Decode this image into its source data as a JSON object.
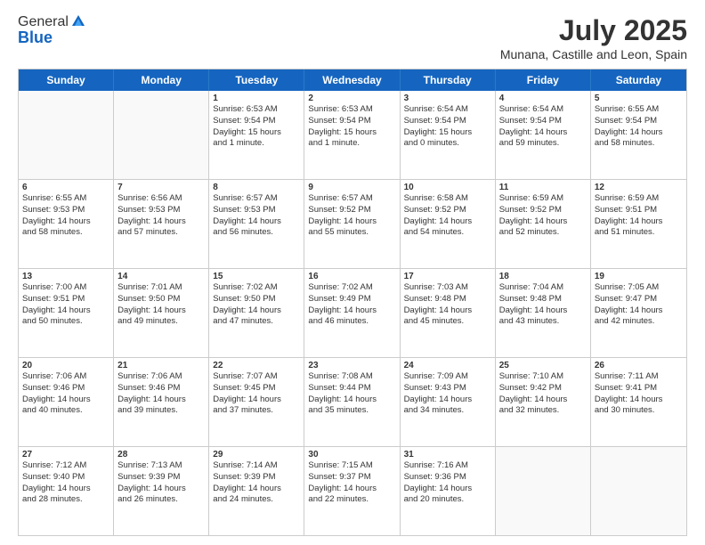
{
  "logo": {
    "general": "General",
    "blue": "Blue"
  },
  "title": "July 2025",
  "subtitle": "Munana, Castille and Leon, Spain",
  "header_days": [
    "Sunday",
    "Monday",
    "Tuesday",
    "Wednesday",
    "Thursday",
    "Friday",
    "Saturday"
  ],
  "weeks": [
    [
      {
        "day": null
      },
      {
        "day": null
      },
      {
        "day": "1",
        "sunrise": "Sunrise: 6:53 AM",
        "sunset": "Sunset: 9:54 PM",
        "daylight": "Daylight: 15 hours and 1 minute."
      },
      {
        "day": "2",
        "sunrise": "Sunrise: 6:53 AM",
        "sunset": "Sunset: 9:54 PM",
        "daylight": "Daylight: 15 hours and 1 minute."
      },
      {
        "day": "3",
        "sunrise": "Sunrise: 6:54 AM",
        "sunset": "Sunset: 9:54 PM",
        "daylight": "Daylight: 15 hours and 0 minutes."
      },
      {
        "day": "4",
        "sunrise": "Sunrise: 6:54 AM",
        "sunset": "Sunset: 9:54 PM",
        "daylight": "Daylight: 14 hours and 59 minutes."
      },
      {
        "day": "5",
        "sunrise": "Sunrise: 6:55 AM",
        "sunset": "Sunset: 9:54 PM",
        "daylight": "Daylight: 14 hours and 58 minutes."
      }
    ],
    [
      {
        "day": "6",
        "sunrise": "Sunrise: 6:55 AM",
        "sunset": "Sunset: 9:53 PM",
        "daylight": "Daylight: 14 hours and 58 minutes."
      },
      {
        "day": "7",
        "sunrise": "Sunrise: 6:56 AM",
        "sunset": "Sunset: 9:53 PM",
        "daylight": "Daylight: 14 hours and 57 minutes."
      },
      {
        "day": "8",
        "sunrise": "Sunrise: 6:57 AM",
        "sunset": "Sunset: 9:53 PM",
        "daylight": "Daylight: 14 hours and 56 minutes."
      },
      {
        "day": "9",
        "sunrise": "Sunrise: 6:57 AM",
        "sunset": "Sunset: 9:52 PM",
        "daylight": "Daylight: 14 hours and 55 minutes."
      },
      {
        "day": "10",
        "sunrise": "Sunrise: 6:58 AM",
        "sunset": "Sunset: 9:52 PM",
        "daylight": "Daylight: 14 hours and 54 minutes."
      },
      {
        "day": "11",
        "sunrise": "Sunrise: 6:59 AM",
        "sunset": "Sunset: 9:52 PM",
        "daylight": "Daylight: 14 hours and 52 minutes."
      },
      {
        "day": "12",
        "sunrise": "Sunrise: 6:59 AM",
        "sunset": "Sunset: 9:51 PM",
        "daylight": "Daylight: 14 hours and 51 minutes."
      }
    ],
    [
      {
        "day": "13",
        "sunrise": "Sunrise: 7:00 AM",
        "sunset": "Sunset: 9:51 PM",
        "daylight": "Daylight: 14 hours and 50 minutes."
      },
      {
        "day": "14",
        "sunrise": "Sunrise: 7:01 AM",
        "sunset": "Sunset: 9:50 PM",
        "daylight": "Daylight: 14 hours and 49 minutes."
      },
      {
        "day": "15",
        "sunrise": "Sunrise: 7:02 AM",
        "sunset": "Sunset: 9:50 PM",
        "daylight": "Daylight: 14 hours and 47 minutes."
      },
      {
        "day": "16",
        "sunrise": "Sunrise: 7:02 AM",
        "sunset": "Sunset: 9:49 PM",
        "daylight": "Daylight: 14 hours and 46 minutes."
      },
      {
        "day": "17",
        "sunrise": "Sunrise: 7:03 AM",
        "sunset": "Sunset: 9:48 PM",
        "daylight": "Daylight: 14 hours and 45 minutes."
      },
      {
        "day": "18",
        "sunrise": "Sunrise: 7:04 AM",
        "sunset": "Sunset: 9:48 PM",
        "daylight": "Daylight: 14 hours and 43 minutes."
      },
      {
        "day": "19",
        "sunrise": "Sunrise: 7:05 AM",
        "sunset": "Sunset: 9:47 PM",
        "daylight": "Daylight: 14 hours and 42 minutes."
      }
    ],
    [
      {
        "day": "20",
        "sunrise": "Sunrise: 7:06 AM",
        "sunset": "Sunset: 9:46 PM",
        "daylight": "Daylight: 14 hours and 40 minutes."
      },
      {
        "day": "21",
        "sunrise": "Sunrise: 7:06 AM",
        "sunset": "Sunset: 9:46 PM",
        "daylight": "Daylight: 14 hours and 39 minutes."
      },
      {
        "day": "22",
        "sunrise": "Sunrise: 7:07 AM",
        "sunset": "Sunset: 9:45 PM",
        "daylight": "Daylight: 14 hours and 37 minutes."
      },
      {
        "day": "23",
        "sunrise": "Sunrise: 7:08 AM",
        "sunset": "Sunset: 9:44 PM",
        "daylight": "Daylight: 14 hours and 35 minutes."
      },
      {
        "day": "24",
        "sunrise": "Sunrise: 7:09 AM",
        "sunset": "Sunset: 9:43 PM",
        "daylight": "Daylight: 14 hours and 34 minutes."
      },
      {
        "day": "25",
        "sunrise": "Sunrise: 7:10 AM",
        "sunset": "Sunset: 9:42 PM",
        "daylight": "Daylight: 14 hours and 32 minutes."
      },
      {
        "day": "26",
        "sunrise": "Sunrise: 7:11 AM",
        "sunset": "Sunset: 9:41 PM",
        "daylight": "Daylight: 14 hours and 30 minutes."
      }
    ],
    [
      {
        "day": "27",
        "sunrise": "Sunrise: 7:12 AM",
        "sunset": "Sunset: 9:40 PM",
        "daylight": "Daylight: 14 hours and 28 minutes."
      },
      {
        "day": "28",
        "sunrise": "Sunrise: 7:13 AM",
        "sunset": "Sunset: 9:39 PM",
        "daylight": "Daylight: 14 hours and 26 minutes."
      },
      {
        "day": "29",
        "sunrise": "Sunrise: 7:14 AM",
        "sunset": "Sunset: 9:39 PM",
        "daylight": "Daylight: 14 hours and 24 minutes."
      },
      {
        "day": "30",
        "sunrise": "Sunrise: 7:15 AM",
        "sunset": "Sunset: 9:37 PM",
        "daylight": "Daylight: 14 hours and 22 minutes."
      },
      {
        "day": "31",
        "sunrise": "Sunrise: 7:16 AM",
        "sunset": "Sunset: 9:36 PM",
        "daylight": "Daylight: 14 hours and 20 minutes."
      },
      {
        "day": null
      },
      {
        "day": null
      }
    ]
  ]
}
